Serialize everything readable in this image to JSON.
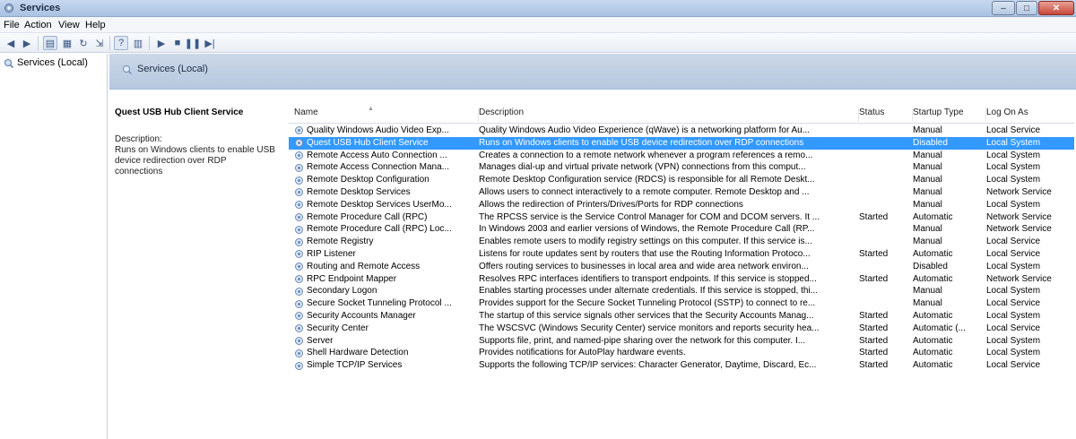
{
  "window": {
    "title": "Services",
    "buttons": {
      "minimize": "–",
      "maximize": "□",
      "close": "✕"
    }
  },
  "menu": [
    "File",
    "Action",
    "View",
    "Help"
  ],
  "tree": {
    "root_label": "Services (Local)"
  },
  "header": {
    "title": "Services (Local)"
  },
  "details": {
    "service_name": "Quest USB Hub Client Service",
    "description_label": "Description:",
    "description": "Runs on Windows clients to enable USB device redirection over RDP connections"
  },
  "columns": {
    "name": "Name",
    "description": "Description",
    "status": "Status",
    "startup": "Startup Type",
    "logon": "Log On As"
  },
  "services": [
    {
      "name": "Quality Windows Audio Video Exp...",
      "description": "Quality Windows Audio Video Experience (qWave) is a networking platform for Au...",
      "status": "",
      "startup": "Manual",
      "logon": "Local Service"
    },
    {
      "name": "Quest USB Hub Client Service",
      "description": "Runs on Windows clients to enable USB device redirection over RDP connections",
      "status": "",
      "startup": "Disabled",
      "logon": "Local System",
      "selected": true
    },
    {
      "name": "Remote Access Auto Connection ...",
      "description": "Creates a connection to a remote network whenever a program references a remo...",
      "status": "",
      "startup": "Manual",
      "logon": "Local System"
    },
    {
      "name": "Remote Access Connection Mana...",
      "description": "Manages dial-up and virtual private network (VPN) connections from this comput...",
      "status": "",
      "startup": "Manual",
      "logon": "Local System"
    },
    {
      "name": "Remote Desktop Configuration",
      "description": "Remote Desktop Configuration service (RDCS) is responsible for all Remote Deskt...",
      "status": "",
      "startup": "Manual",
      "logon": "Local System"
    },
    {
      "name": "Remote Desktop Services",
      "description": "Allows users to connect interactively to a remote computer. Remote Desktop and ...",
      "status": "",
      "startup": "Manual",
      "logon": "Network Service"
    },
    {
      "name": "Remote Desktop Services UserMo...",
      "description": "Allows the redirection of Printers/Drives/Ports for RDP connections",
      "status": "",
      "startup": "Manual",
      "logon": "Local System"
    },
    {
      "name": "Remote Procedure Call (RPC)",
      "description": "The RPCSS service is the Service Control Manager for COM and DCOM servers. It ...",
      "status": "Started",
      "startup": "Automatic",
      "logon": "Network Service"
    },
    {
      "name": "Remote Procedure Call (RPC) Loc...",
      "description": "In Windows 2003 and earlier versions of Windows, the Remote Procedure Call (RP...",
      "status": "",
      "startup": "Manual",
      "logon": "Network Service"
    },
    {
      "name": "Remote Registry",
      "description": "Enables remote users to modify registry settings on this computer. If this service is...",
      "status": "",
      "startup": "Manual",
      "logon": "Local Service"
    },
    {
      "name": "RIP Listener",
      "description": "Listens for route updates sent by routers that use the Routing Information Protoco...",
      "status": "Started",
      "startup": "Automatic",
      "logon": "Local Service"
    },
    {
      "name": "Routing and Remote Access",
      "description": "Offers routing services to businesses in local area and wide area network environ...",
      "status": "",
      "startup": "Disabled",
      "logon": "Local System"
    },
    {
      "name": "RPC Endpoint Mapper",
      "description": "Resolves RPC interfaces identifiers to transport endpoints. If this service is stopped...",
      "status": "Started",
      "startup": "Automatic",
      "logon": "Network Service"
    },
    {
      "name": "Secondary Logon",
      "description": "Enables starting processes under alternate credentials. If this service is stopped, thi...",
      "status": "",
      "startup": "Manual",
      "logon": "Local System"
    },
    {
      "name": "Secure Socket Tunneling Protocol ...",
      "description": "Provides support for the Secure Socket Tunneling Protocol (SSTP) to connect to re...",
      "status": "",
      "startup": "Manual",
      "logon": "Local Service"
    },
    {
      "name": "Security Accounts Manager",
      "description": "The startup of this service signals other services that the Security Accounts Manag...",
      "status": "Started",
      "startup": "Automatic",
      "logon": "Local System"
    },
    {
      "name": "Security Center",
      "description": "The WSCSVC (Windows Security Center) service monitors and reports security hea...",
      "status": "Started",
      "startup": "Automatic (...",
      "logon": "Local Service"
    },
    {
      "name": "Server",
      "description": "Supports file, print, and named-pipe sharing over the network for this computer. I...",
      "status": "Started",
      "startup": "Automatic",
      "logon": "Local System"
    },
    {
      "name": "Shell Hardware Detection",
      "description": "Provides notifications for AutoPlay hardware events.",
      "status": "Started",
      "startup": "Automatic",
      "logon": "Local System"
    },
    {
      "name": "Simple TCP/IP Services",
      "description": "Supports the following TCP/IP services: Character Generator, Daytime, Discard, Ec...",
      "status": "Started",
      "startup": "Automatic",
      "logon": "Local Service"
    }
  ],
  "colors": {
    "selection": "#3399ff",
    "header_bar": "#b6c8df",
    "titlebar": "#a9c2e2"
  },
  "icons": {
    "service": "gear-icon",
    "tree": "services-icon"
  }
}
